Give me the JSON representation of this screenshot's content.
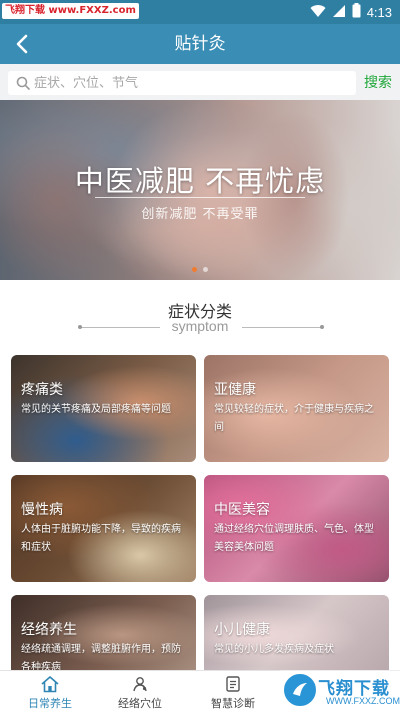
{
  "status_bar": {
    "watermark": "飞翔下载 www.FXXZ.com",
    "time": "4:13"
  },
  "header": {
    "title": "贴针灸"
  },
  "search": {
    "placeholder": "症状、穴位、节气",
    "button_label": "搜索"
  },
  "banner": {
    "title": "中医减肥 不再忧虑",
    "subtitle": "创新减肥 不再受罪",
    "slide_count": 2,
    "active_slide": 1
  },
  "section": {
    "title": "症状分类",
    "subtitle": "symptom"
  },
  "categories": [
    {
      "title": "疼痛类",
      "desc": "常见的关节疼痛及局部疼痛等问题"
    },
    {
      "title": "亚健康",
      "desc": "常见较轻的症状，介于健康与疾病之间"
    },
    {
      "title": "慢性病",
      "desc": "人体由于脏腑功能下降，导致的疾病和症状"
    },
    {
      "title": "中医美容",
      "desc": "通过经络穴位调理肤质、气色、体型美容美体问题"
    },
    {
      "title": "经络养生",
      "desc": "经络疏通调理，调整脏腑作用，预防各种疾病"
    },
    {
      "title": "小儿健康",
      "desc": "常见的小儿多发疾病及症状"
    }
  ],
  "tabbar": {
    "tabs": [
      {
        "label": "日常养生",
        "icon": "home-icon",
        "active": true
      },
      {
        "label": "经络穴位",
        "icon": "acupoint-icon",
        "active": false
      },
      {
        "label": "智慧诊断",
        "icon": "diagnosis-icon",
        "active": false
      }
    ]
  },
  "watermark_bottom": {
    "text": "飞翔下载",
    "url": "WWW.FXXZ.COM"
  },
  "colors": {
    "header": "#3a8db4",
    "status_bar": "#2f7fa3",
    "search_button": "#20a83a",
    "tab_active": "#2f86b5",
    "banner_dot_active": "#f07b2e"
  }
}
